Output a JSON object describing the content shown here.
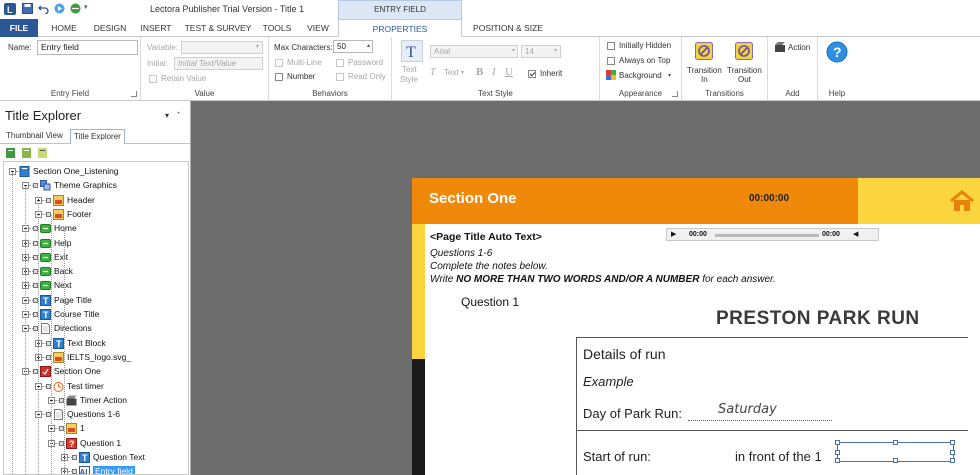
{
  "window": {
    "title": "Lectora Publisher Trial Version - Title 1",
    "context_tab_group": "ENTRY FIELD"
  },
  "tabs": [
    "FILE",
    "HOME",
    "DESIGN",
    "INSERT",
    "TEST & SURVEY",
    "TOOLS",
    "VIEW",
    "PROPERTIES",
    "POSITION & SIZE"
  ],
  "active_tab": "PROPERTIES",
  "ribbon": {
    "entry_field": {
      "label": "Entry Field",
      "name_label": "Name:",
      "name_value": "Entry field"
    },
    "value": {
      "label": "Value",
      "variable_label": "Variable:",
      "initial_label": "Initial:",
      "initial_placeholder": "Initial Text/Value",
      "retain_label": "Retain Value"
    },
    "behaviors": {
      "label": "Behaviors",
      "max_chars_label": "Max Characters:",
      "max_chars_value": "50",
      "multiline_label": "Multi-Line",
      "password_label": "Password",
      "number_label": "Number",
      "readonly_label": "Read Only"
    },
    "text_style": {
      "label": "Text Style",
      "text_style_btn": "Text",
      "text_style_btn2": "Style",
      "font_value": "Arial",
      "size_value": "14",
      "text_btn": "Text",
      "bold": "B",
      "italic": "I",
      "underline": "U",
      "inherit_label": "Inherit"
    },
    "appearance": {
      "label": "Appearance",
      "initially_hidden": "Initially Hidden",
      "always_on_top": "Always on Top",
      "background": "Background"
    },
    "transitions": {
      "label": "Transitions",
      "in_1": "Transition",
      "in_2": "In",
      "out_1": "Transition",
      "out_2": "Out"
    },
    "add": {
      "label": "Add",
      "action": "Action"
    },
    "help": {
      "label": "Help"
    }
  },
  "left_panel": {
    "title": "Title Explorer",
    "tabs": [
      "Thumbnail View",
      "Title Explorer"
    ],
    "tree": [
      {
        "label": "Section One_Listening",
        "level": 0,
        "icon": "book-icon"
      },
      {
        "label": "Theme Graphics",
        "level": 1,
        "icon": "group-icon"
      },
      {
        "label": "Header",
        "level": 2,
        "icon": "image-icon"
      },
      {
        "label": "Footer",
        "level": 2,
        "icon": "image-icon"
      },
      {
        "label": "Home",
        "level": 1,
        "icon": "button-icon"
      },
      {
        "label": "Help",
        "level": 1,
        "icon": "button-icon"
      },
      {
        "label": "Exit",
        "level": 1,
        "icon": "button-icon"
      },
      {
        "label": "Back",
        "level": 1,
        "icon": "button-icon"
      },
      {
        "label": "Next",
        "level": 1,
        "icon": "button-icon"
      },
      {
        "label": "Page Title",
        "level": 1,
        "icon": "text-icon"
      },
      {
        "label": "Course Title",
        "level": 1,
        "icon": "text-icon"
      },
      {
        "label": "Directions",
        "level": 1,
        "icon": "page-icon"
      },
      {
        "label": "Text Block",
        "level": 2,
        "icon": "text-icon"
      },
      {
        "label": "IELTS_logo.svg_",
        "level": 2,
        "icon": "image-icon"
      },
      {
        "label": "Section One",
        "level": 1,
        "icon": "test-icon"
      },
      {
        "label": "Test timer",
        "level": 2,
        "icon": "timer-icon"
      },
      {
        "label": "Timer Action",
        "level": 3,
        "icon": "action-icon"
      },
      {
        "label": "Questions 1-6",
        "level": 2,
        "icon": "page-icon"
      },
      {
        "label": "1",
        "level": 3,
        "icon": "image-icon"
      },
      {
        "label": "Question 1",
        "level": 3,
        "icon": "question-icon"
      },
      {
        "label": "Question Text",
        "level": 4,
        "icon": "text-icon"
      },
      {
        "label": "Entry field",
        "level": 4,
        "icon": "entry-field-icon",
        "selected": true
      }
    ]
  },
  "page": {
    "section_title": "Section One",
    "timer": "00:00:00",
    "page_title_auto": "<Page Title Auto Text>",
    "audio_start": "00:00",
    "audio_end": "00:00",
    "instr_1": "Questions 1-6",
    "instr_2": "Complete the notes below.",
    "instr_3a": "Write ",
    "instr_3b": "NO MORE THAN TWO WORDS AND/OR A NUMBER",
    "instr_3c": " for each answer.",
    "question_label": "Question 1",
    "form_title": "PRESTON PARK RUN",
    "details_heading": "Details of run",
    "example": "Example",
    "day_label": "Day of Park Run:",
    "day_answer": "Saturday",
    "start_label": "Start of run:",
    "start_text": "in front of the 1"
  },
  "colors": {
    "header_orange": "#f0880a",
    "header_yellow": "#fbd53d",
    "file_tab": "#2b5797",
    "selection": "#3399ff"
  }
}
